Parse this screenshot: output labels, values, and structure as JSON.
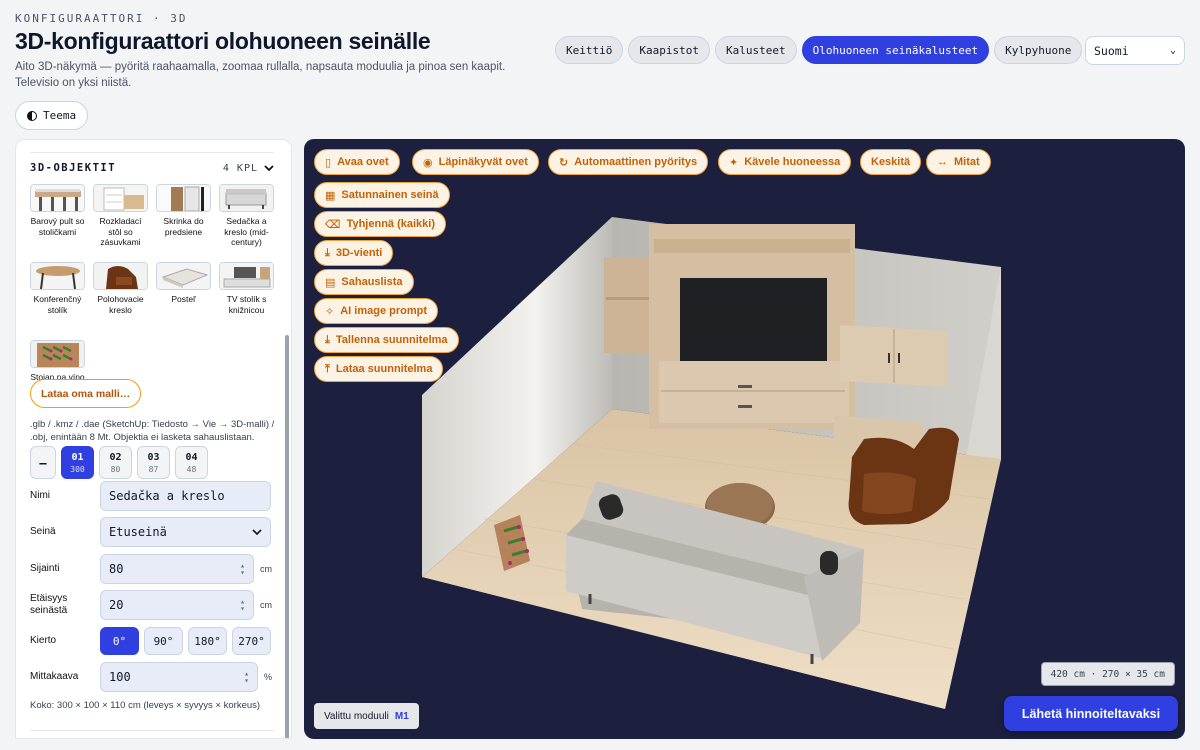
{
  "header": {
    "eyebrow": "KONFIGURAATTORI · 3D",
    "title": "3D-konfiguraattori olohuoneen seinälle",
    "subtitle": "Aito 3D-näkymä — pyöritä raahaamalla, zoomaa rullalla, napsauta moduulia ja pinoa sen kaapit. Televisio on yksi niistä.",
    "theme_label": "Teema"
  },
  "nav": {
    "tabs": [
      "Keittiö",
      "Kaapistot",
      "Kalusteet",
      "Olohuoneen seinäkalusteet",
      "Kylpyhuone"
    ],
    "active_index": 3,
    "language": "Suomi"
  },
  "sidebar": {
    "objects_title": "3D-OBJEKTIT",
    "objects_count": "4 KPL",
    "thumbnails": [
      {
        "label": "Barový pult so stoličkami",
        "icon": "bar-counter-icon"
      },
      {
        "label": "Rozkladací stôl so zásuvkami",
        "icon": "folding-table-icon"
      },
      {
        "label": "Skrinka do predsiene",
        "icon": "hallway-cabinet-icon"
      },
      {
        "label": "Sedačka a kreslo (mid-century)",
        "icon": "sofa-armchair-icon"
      },
      {
        "label": "Konferenčný stolík",
        "icon": "coffee-table-icon"
      },
      {
        "label": "Polohovacie kreslo",
        "icon": "recliner-icon"
      },
      {
        "label": "Posteľ",
        "icon": "bed-icon"
      },
      {
        "label": "TV stolík s knižnicou",
        "icon": "tv-stand-icon"
      },
      {
        "label": "Stojan na víno",
        "icon": "wine-rack-icon"
      }
    ],
    "upload_label": "Lataa oma malli…",
    "upload_note": ".glb / .kmz / .dae (SketchUp: Tiedosto → Vie → 3D-malli) / .obj, enintään 8 Mt. Objektia ei lasketa sahauslistaan.",
    "modules": [
      {
        "num": "01",
        "size": "300"
      },
      {
        "num": "02",
        "size": "80"
      },
      {
        "num": "03",
        "size": "87"
      },
      {
        "num": "04",
        "size": "48"
      }
    ],
    "minus_label": "—",
    "form": {
      "name_label": "Nimi",
      "name_value": "Sedačka a kreslo",
      "wall_label": "Seinä",
      "wall_value": "Etuseinä",
      "position_label": "Sijainti",
      "position_value": "80",
      "position_unit": "cm",
      "distance_label": "Etäisyys seinästä",
      "distance_value": "20",
      "distance_unit": "cm",
      "rotation_label": "Kierto",
      "rotations": [
        "0°",
        "90°",
        "180°",
        "270°"
      ],
      "scale_label": "Mittakaava",
      "scale_value": "100",
      "scale_unit": "%",
      "size_note": "Koko: 300 × 100 × 110 cm (leveys × syvyys × korkeus)"
    }
  },
  "toolbar": {
    "open_doors": "Avaa ovet",
    "transparent_doors": "Läpinäkyvät ovet",
    "auto_rotate": "Automaattinen pyöritys",
    "walk_room": "Kävele huoneessa",
    "center": "Keskitä",
    "dimensions": "Mitat",
    "random_wall": "Satunnainen seinä",
    "clear_all": "Tyhjennä (kaikki)",
    "export_3d": "3D-vienti",
    "cut_list": "Sahauslista",
    "ai_prompt": "AI image prompt",
    "save_plan": "Tallenna suunnitelma",
    "load_plan": "Lataa suunnitelma"
  },
  "viewport": {
    "room_dims": "420 cm · 270 × 35 cm",
    "selected_label": "Valittu moduuli",
    "selected_value": "M1",
    "send_label": "Lähetä hinnoiteltavaksi"
  },
  "colors": {
    "accent": "#2f3fe0",
    "tool_border": "#f0a33b",
    "tool_text": "#c2620a",
    "viewport_bg": "#1c1f3d"
  }
}
